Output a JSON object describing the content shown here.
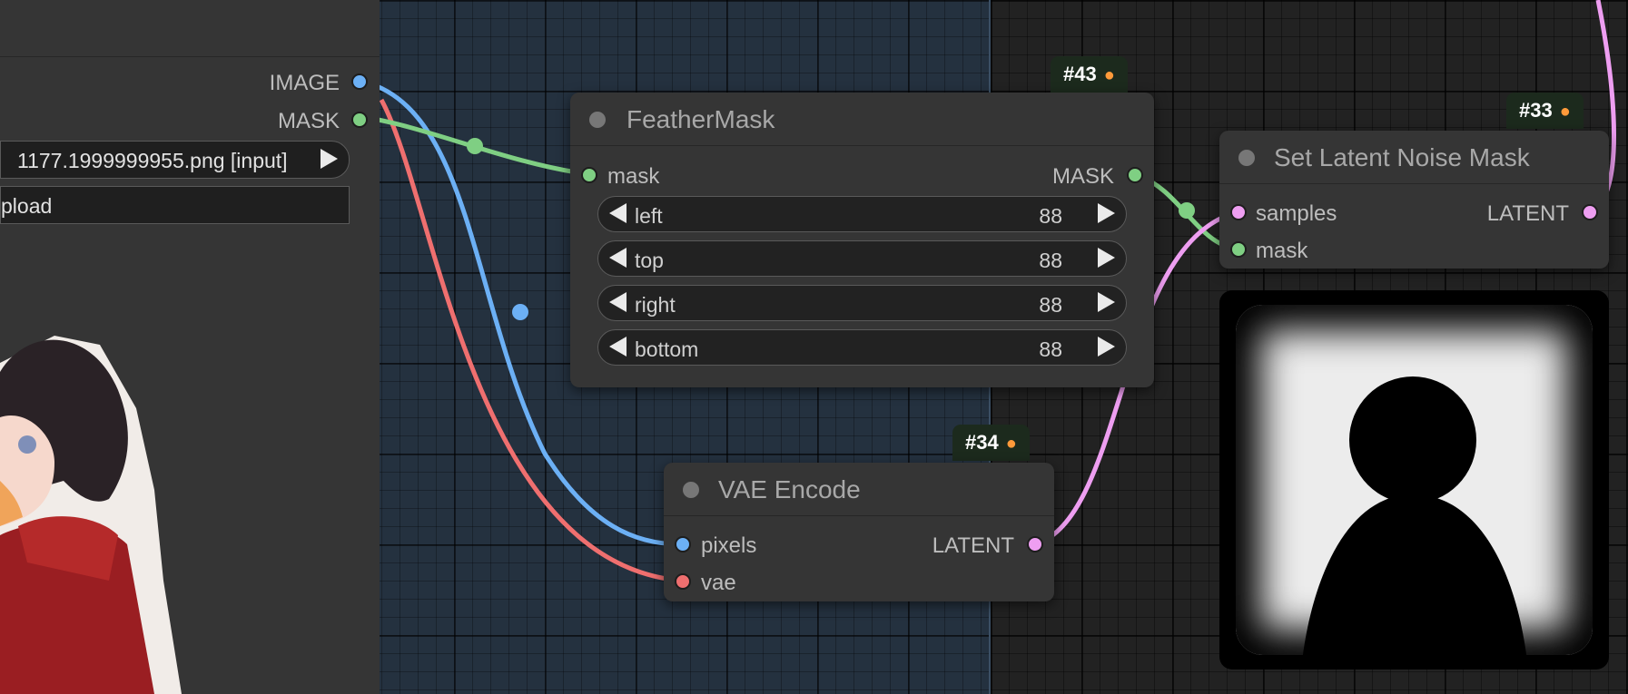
{
  "colors": {
    "wire_image": "#6cb0f5",
    "wire_mask": "#7fcf83",
    "wire_latent": "#ee9ef1",
    "wire_vae": "#ef6f6f"
  },
  "load_image": {
    "outputs": [
      "IMAGE",
      "MASK"
    ],
    "image_combo": "1177.1999999955.png [input]",
    "upload_button": "pload"
  },
  "feather_mask": {
    "badge": "#43",
    "title": "FeatherMask",
    "input": "mask",
    "output": "MASK",
    "widgets": [
      {
        "label": "left",
        "value": "88"
      },
      {
        "label": "top",
        "value": "88"
      },
      {
        "label": "right",
        "value": "88"
      },
      {
        "label": "bottom",
        "value": "88"
      }
    ]
  },
  "vae_encode": {
    "badge": "#34",
    "title": "VAE Encode",
    "inputs": [
      "pixels",
      "vae"
    ],
    "output": "LATENT"
  },
  "set_latent_noise_mask": {
    "badge": "#33",
    "title": "Set Latent Noise Mask",
    "inputs": [
      "samples",
      "mask"
    ],
    "output": "LATENT"
  },
  "badge_icon": "fox-icon"
}
